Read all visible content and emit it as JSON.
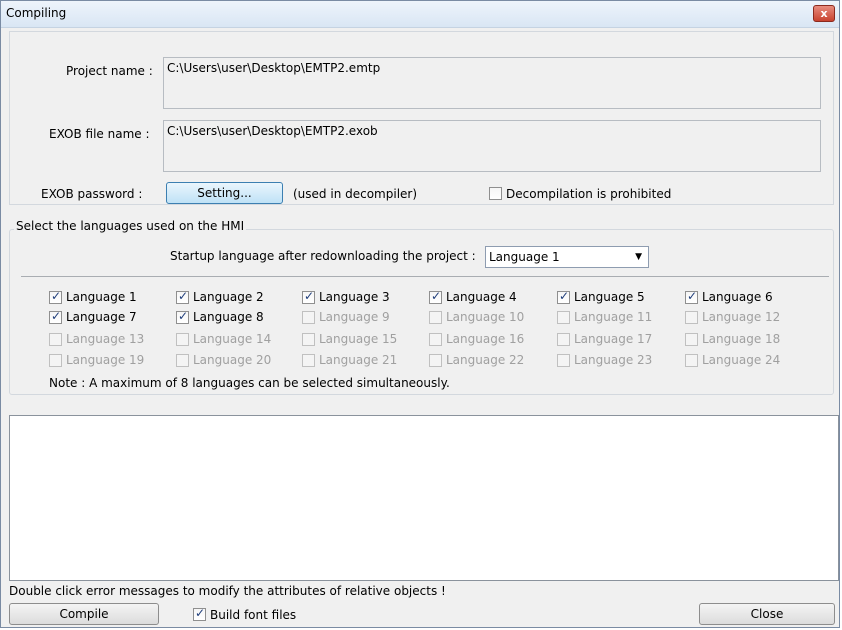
{
  "window": {
    "title": "Compiling",
    "close_label": "x"
  },
  "project": {
    "project_name_label": "Project name :",
    "project_name_value": "C:\\Users\\user\\Desktop\\EMTP2.emtp",
    "exob_label": "EXOB file name :",
    "exob_value": "C:\\Users\\user\\Desktop\\EMTP2.exob",
    "password_label": "EXOB password :",
    "setting_button": "Setting...",
    "decompiler_note": "(used in decompiler)",
    "decompilation_prohibited_label": "Decompilation is prohibited",
    "decompilation_prohibited_checked": false
  },
  "languages": {
    "group_title": "Select the languages used on the HMI",
    "startup_label": "Startup language after redownloading the project :",
    "startup_value": "Language 1",
    "items": [
      {
        "label": "Language 1",
        "checked": true,
        "enabled": true
      },
      {
        "label": "Language 2",
        "checked": true,
        "enabled": true
      },
      {
        "label": "Language 3",
        "checked": true,
        "enabled": true
      },
      {
        "label": "Language 4",
        "checked": true,
        "enabled": true
      },
      {
        "label": "Language 5",
        "checked": true,
        "enabled": true
      },
      {
        "label": "Language 6",
        "checked": true,
        "enabled": true
      },
      {
        "label": "Language 7",
        "checked": true,
        "enabled": true
      },
      {
        "label": "Language 8",
        "checked": true,
        "enabled": true
      },
      {
        "label": "Language 9",
        "checked": false,
        "enabled": false
      },
      {
        "label": "Language 10",
        "checked": false,
        "enabled": false
      },
      {
        "label": "Language 11",
        "checked": false,
        "enabled": false
      },
      {
        "label": "Language 12",
        "checked": false,
        "enabled": false
      },
      {
        "label": "Language 13",
        "checked": false,
        "enabled": false
      },
      {
        "label": "Language 14",
        "checked": false,
        "enabled": false
      },
      {
        "label": "Language 15",
        "checked": false,
        "enabled": false
      },
      {
        "label": "Language 16",
        "checked": false,
        "enabled": false
      },
      {
        "label": "Language 17",
        "checked": false,
        "enabled": false
      },
      {
        "label": "Language 18",
        "checked": false,
        "enabled": false
      },
      {
        "label": "Language 19",
        "checked": false,
        "enabled": false
      },
      {
        "label": "Language 20",
        "checked": false,
        "enabled": false
      },
      {
        "label": "Language 21",
        "checked": false,
        "enabled": false
      },
      {
        "label": "Language 22",
        "checked": false,
        "enabled": false
      },
      {
        "label": "Language 23",
        "checked": false,
        "enabled": false
      },
      {
        "label": "Language 24",
        "checked": false,
        "enabled": false
      }
    ],
    "note": "Note : A maximum of 8 languages can be selected simultaneously."
  },
  "footer": {
    "hint": "Double click error messages to modify the attributes of relative objects !",
    "compile_button": "Compile",
    "build_font_label": "Build font files",
    "build_font_checked": true,
    "close_button": "Close"
  }
}
